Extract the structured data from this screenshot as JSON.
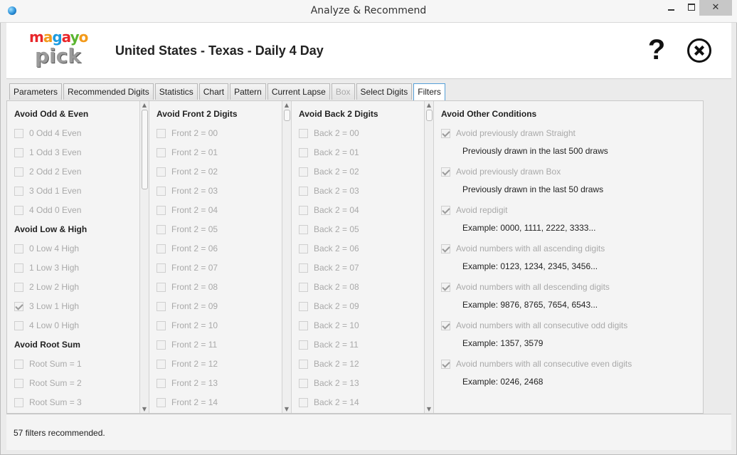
{
  "window": {
    "title": "Analyze & Recommend",
    "min_icon": "minimize-icon",
    "max_icon": "maximize-icon",
    "close_icon": "close-icon"
  },
  "header": {
    "logo_top": "magayo",
    "logo_bottom": "pick",
    "game_title": "United States - Texas - Daily 4 Day",
    "help_label": "?",
    "help_icon": "question-icon",
    "close_icon": "circle-close-icon"
  },
  "tabs": [
    {
      "label": "Parameters",
      "state": "normal"
    },
    {
      "label": "Recommended Digits",
      "state": "normal"
    },
    {
      "label": "Statistics",
      "state": "normal"
    },
    {
      "label": "Chart",
      "state": "normal"
    },
    {
      "label": "Pattern",
      "state": "normal"
    },
    {
      "label": "Current Lapse",
      "state": "normal"
    },
    {
      "label": "Box",
      "state": "disabled"
    },
    {
      "label": "Select Digits",
      "state": "normal"
    },
    {
      "label": "Filters",
      "state": "active"
    }
  ],
  "col1": {
    "groups": [
      {
        "title": "Avoid Odd & Even",
        "items": [
          {
            "label": "0 Odd 4 Even",
            "checked": false
          },
          {
            "label": "1 Odd 3 Even",
            "checked": false
          },
          {
            "label": "2 Odd 2 Even",
            "checked": false
          },
          {
            "label": "3 Odd 1 Even",
            "checked": false
          },
          {
            "label": "4 Odd 0 Even",
            "checked": false
          }
        ]
      },
      {
        "title": "Avoid Low & High",
        "items": [
          {
            "label": "0 Low 4 High",
            "checked": false
          },
          {
            "label": "1 Low 3 High",
            "checked": false
          },
          {
            "label": "2 Low 2 High",
            "checked": false
          },
          {
            "label": "3 Low 1 High",
            "checked": true
          },
          {
            "label": "4 Low 0 High",
            "checked": false
          }
        ]
      },
      {
        "title": "Avoid Root Sum",
        "items": [
          {
            "label": "Root Sum =  1",
            "checked": false
          },
          {
            "label": "Root Sum =  2",
            "checked": false
          },
          {
            "label": "Root Sum =  3",
            "checked": false
          }
        ]
      }
    ]
  },
  "col2": {
    "title": "Avoid Front 2 Digits",
    "items": [
      "Front 2 =  00",
      "Front 2 =  01",
      "Front 2 =  02",
      "Front 2 =  03",
      "Front 2 =  04",
      "Front 2 =  05",
      "Front 2 =  06",
      "Front 2 =  07",
      "Front 2 =  08",
      "Front 2 =  09",
      "Front 2 =  10",
      "Front 2 =  11",
      "Front 2 =  12",
      "Front 2 =  13",
      "Front 2 =  14"
    ]
  },
  "col3": {
    "title": "Avoid Back 2 Digits",
    "items": [
      "Back 2 =  00",
      "Back 2 =  01",
      "Back 2 =  02",
      "Back 2 =  03",
      "Back 2 =  04",
      "Back 2 =  05",
      "Back 2 =  06",
      "Back 2 =  07",
      "Back 2 =  08",
      "Back 2 =  09",
      "Back 2 =  10",
      "Back 2 =  11",
      "Back 2 =  12",
      "Back 2 =  13",
      "Back 2 =  14"
    ]
  },
  "col4": {
    "title": "Avoid Other Conditions",
    "conditions": [
      {
        "label": "Avoid previously drawn Straight",
        "checked": true,
        "note": "Previously drawn in the last 500 draws"
      },
      {
        "label": "Avoid previously drawn Box",
        "checked": true,
        "note": "Previously drawn in the last 50 draws"
      },
      {
        "label": "Avoid repdigit",
        "checked": true,
        "note": "Example: 0000, 1111, 2222, 3333..."
      },
      {
        "label": "Avoid numbers with all ascending digits",
        "checked": true,
        "note": "Example: 0123, 1234, 2345, 3456..."
      },
      {
        "label": "Avoid numbers with all descending digits",
        "checked": true,
        "note": "Example: 9876, 8765, 7654, 6543..."
      },
      {
        "label": "Avoid numbers with all consecutive odd digits",
        "checked": true,
        "note": "Example: 1357, 3579"
      },
      {
        "label": "Avoid numbers with all consecutive even digits",
        "checked": true,
        "note": "Example: 0246, 2468"
      }
    ]
  },
  "status": {
    "text": "57 filters recommended."
  },
  "colors": {
    "accent_tab_border": "#56a0d8",
    "disabled_text": "#a9a9a9"
  }
}
